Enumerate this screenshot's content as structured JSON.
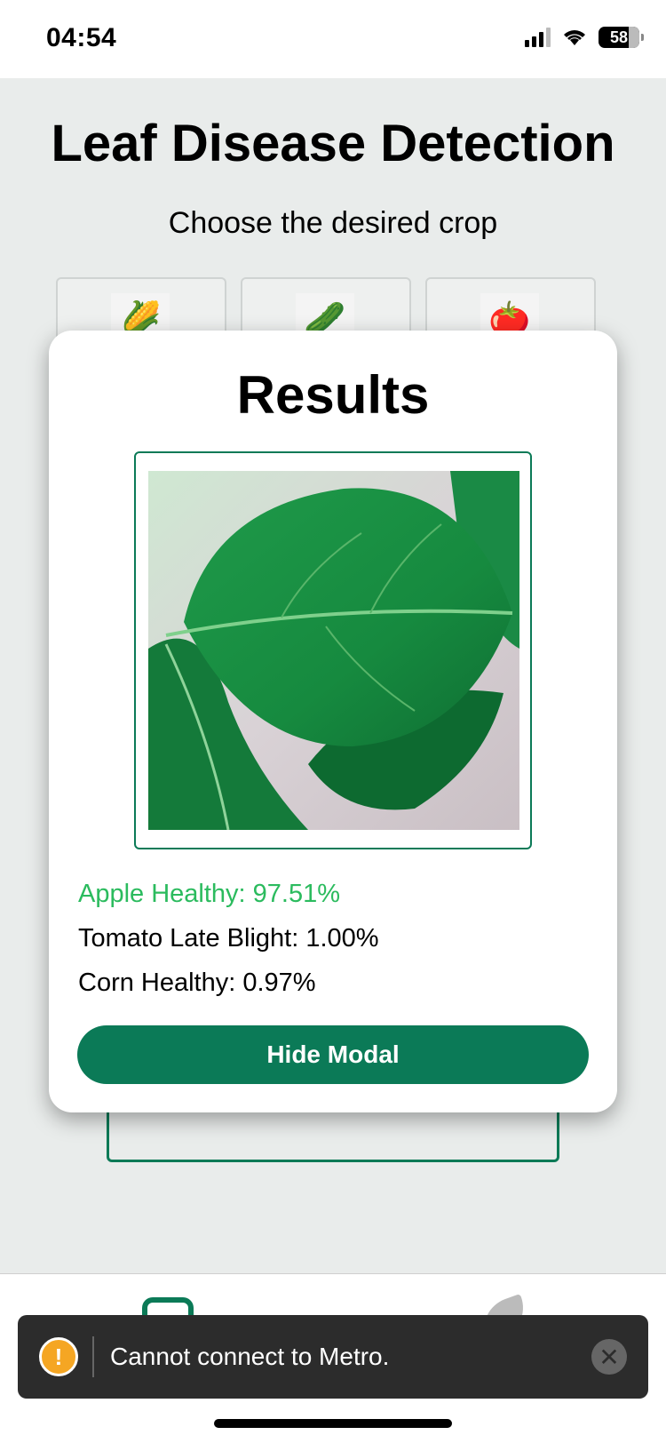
{
  "status_bar": {
    "time": "04:54",
    "battery": "58"
  },
  "app": {
    "title": "Leaf Disease Detection",
    "subtitle": "Choose the desired crop",
    "crops": [
      {
        "icon": "corn-icon",
        "glyph": "🌽"
      },
      {
        "icon": "cucumber-icon",
        "glyph": "🥒"
      },
      {
        "icon": "tomato-icon",
        "glyph": "🍅"
      }
    ]
  },
  "modal": {
    "title": "Results",
    "image_icon": "apple-leaf-image",
    "results": [
      {
        "label": "Apple Healthy: 97.51%",
        "color": "#2bbb5e"
      },
      {
        "label": "Tomato Late Blight: 1.00%",
        "color": "#000000"
      },
      {
        "label": "Corn Healthy: 0.97%",
        "color": "#000000"
      }
    ],
    "button_label": "Hide Modal"
  },
  "toast": {
    "message": "Cannot connect to Metro.",
    "icon": "warning-icon",
    "close_glyph": "✕",
    "warning_glyph": "!"
  },
  "colors": {
    "accent": "#0b7a57",
    "success": "#2bbb5e",
    "background": "#e9eceb"
  }
}
